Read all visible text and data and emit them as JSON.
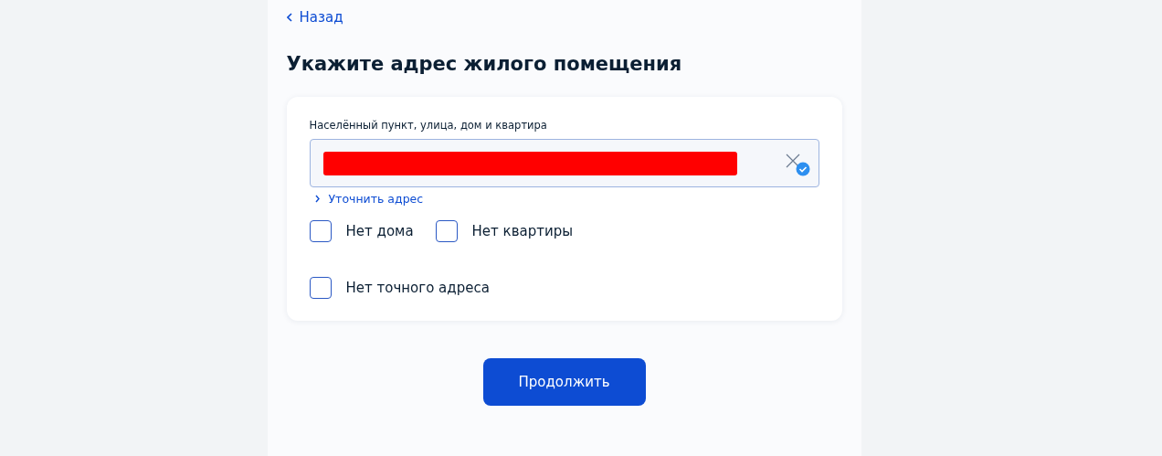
{
  "back_link": {
    "label": "Назад"
  },
  "title": "Укажите адрес жилого помещения",
  "address_field": {
    "label": "Населённый пункт, улица, дом и квартира",
    "redacted": true,
    "verified": true
  },
  "refine_link": {
    "label": "Уточнить адрес"
  },
  "checkboxes": [
    {
      "label": "Нет дома",
      "checked": false
    },
    {
      "label": "Нет квартиры",
      "checked": false
    },
    {
      "label": "Нет точного адреса",
      "checked": false
    }
  ],
  "continue_button": {
    "label": "Продолжить"
  }
}
